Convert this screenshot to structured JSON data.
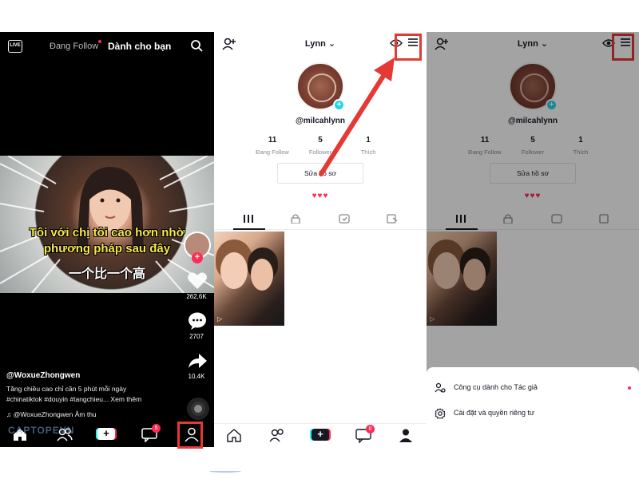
{
  "feed": {
    "live_label": "LIVE",
    "tab_following": "Đang Follow",
    "tab_for_you": "Dành cho bạn",
    "caption_line1": "Tôi với chị tôi cao hơn nhờ",
    "caption_line2": "phương pháp sau đây",
    "caption_line3": "一个比一个高",
    "like_count": "262,6K",
    "comment_count": "2707",
    "share_count": "10,4K",
    "username": "@WoxueZhongwen",
    "description_line1": "Tăng chiều cao chỉ cần 5 phút mỗi ngày",
    "description_line2": "#chinatiktok #douyin #tangchieu... Xem thêm",
    "music": "♫  @WoxueZhongwen Âm thu",
    "inbox_badge": "5",
    "watermark": "CAPTOPEVN"
  },
  "profile": {
    "name": "Lynn",
    "handle": "@milcahlynn",
    "following_count": "11",
    "following_label": "Đang Follow",
    "followers_count": "5",
    "followers_label": "Follower",
    "likes_count": "1",
    "likes_label": "Thích",
    "edit_profile": "Sửa hồ sơ",
    "hearts": "♥♥♥",
    "inbox_badge": "8"
  },
  "sheet": {
    "creator_tools": "Công cụ dành cho Tác giả",
    "settings_privacy": "Cài đặt và quyền riêng tư"
  },
  "colors": {
    "accent_red": "#fe2c55",
    "accent_cyan": "#20d5ec",
    "highlight": "#e53935"
  }
}
